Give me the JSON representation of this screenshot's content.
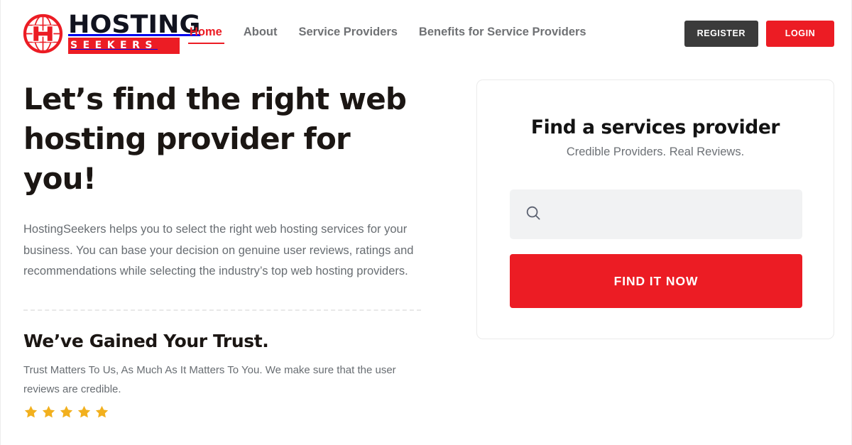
{
  "header": {
    "logo": {
      "icon": "globe-h-icon",
      "wordmark_top": "HOSTING",
      "wordmark_bottom": "SEEKERS",
      "brand_red": "#ec1c24",
      "brand_dark": "#11131f"
    },
    "nav": [
      {
        "label": "Home",
        "active": true
      },
      {
        "label": "About",
        "active": false
      },
      {
        "label": "Service Providers",
        "active": false
      },
      {
        "label": "Benefits for Service Providers",
        "active": false
      }
    ],
    "actions": {
      "register_label": "REGISTER",
      "register_color": "#3b3b3b",
      "login_label": "LOGIN",
      "login_color": "#ec1c24"
    }
  },
  "hero": {
    "title": "Let’s find the right web hosting provider for you!",
    "paragraph": "HostingSeekers helps you to select the right web hosting services for your business. You can base your decision on genuine user reviews, ratings and recommendations while selecting the industry’s top web hosting providers.",
    "trust": {
      "title": "We’ve Gained Your Trust.",
      "text": "Trust Matters To Us, As Much As It Matters To You. We make sure that the user reviews are credible.",
      "rating": 5,
      "star_color": "#f2b01e"
    }
  },
  "search_card": {
    "title": "Find a services provider",
    "subtitle": "Credible Providers. Real Reviews.",
    "search": {
      "icon": "search-icon",
      "value": "",
      "placeholder": ""
    },
    "cta_label": "FIND IT NOW",
    "cta_color": "#ec1c24"
  }
}
